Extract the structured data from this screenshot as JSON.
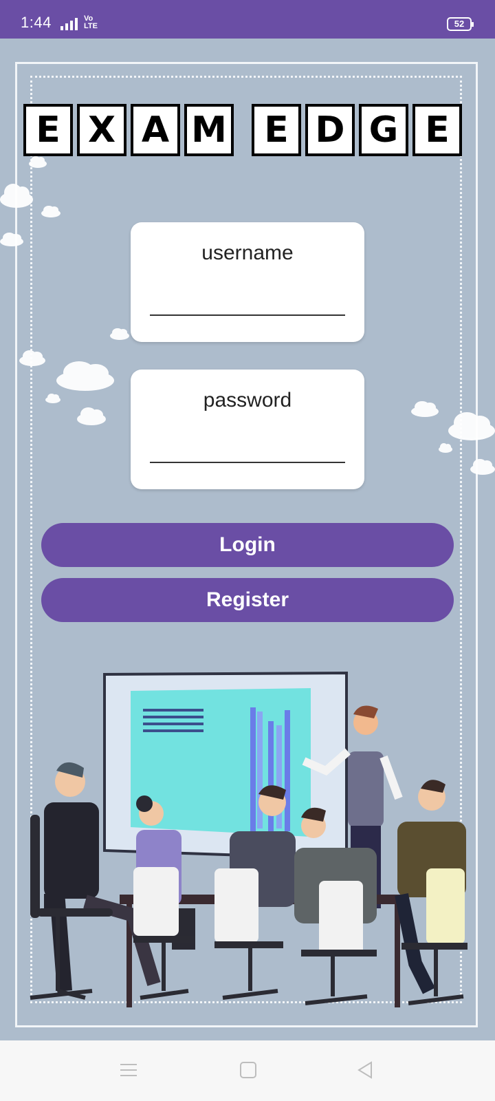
{
  "status_bar": {
    "time": "1:44",
    "network": "Vo LTE",
    "battery": "52"
  },
  "title": {
    "word1": [
      "E",
      "X",
      "A",
      "M"
    ],
    "word2": [
      "E",
      "D",
      "G",
      "E"
    ]
  },
  "form": {
    "username_label": "username",
    "password_label": "password"
  },
  "buttons": {
    "login": "Login",
    "register": "Register"
  },
  "colors": {
    "accent": "#6a4ea5",
    "background": "#adbccc"
  },
  "nav": {
    "icons": [
      "menu-icon",
      "home-icon",
      "back-icon"
    ]
  }
}
